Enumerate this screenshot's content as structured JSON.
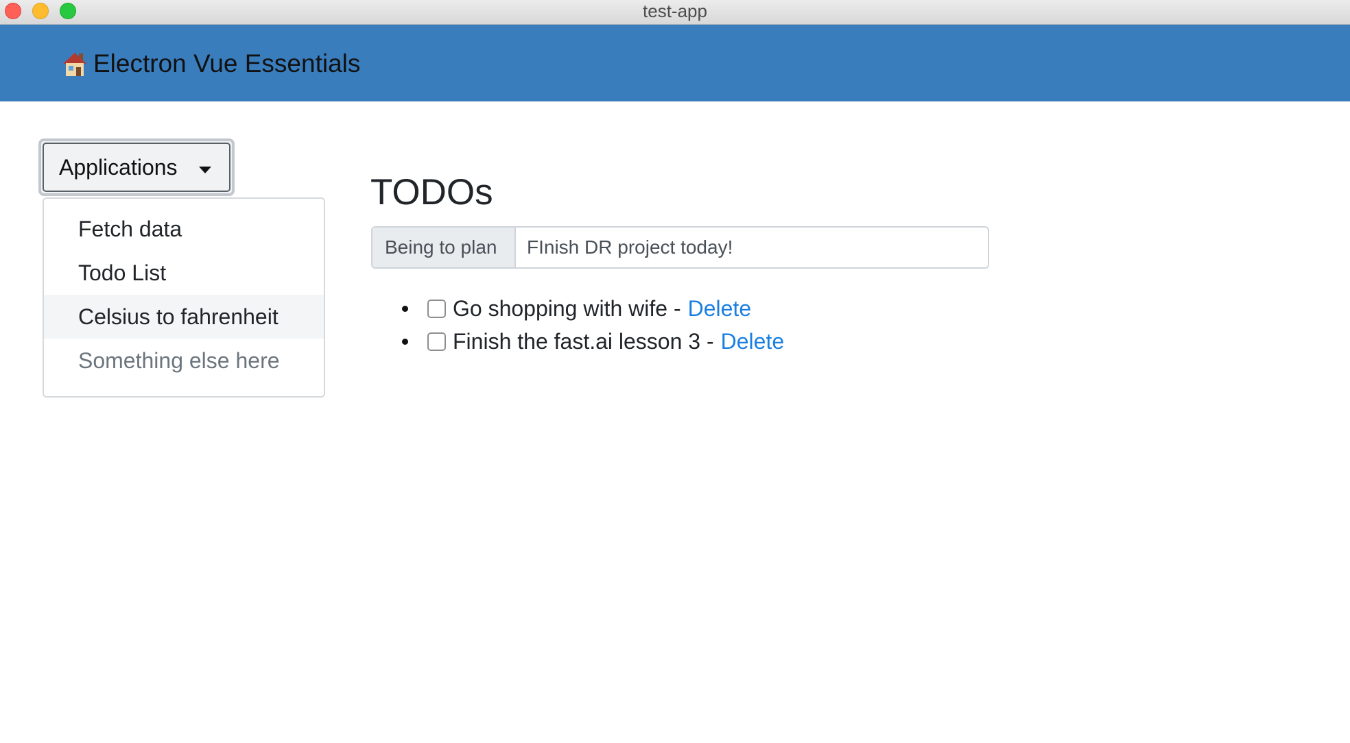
{
  "window": {
    "title": "test-app"
  },
  "navbar": {
    "brand": "Electron Vue Essentials",
    "brand_icon": "house-icon",
    "background": "#3a7dbd"
  },
  "dropdown": {
    "toggle_label": "Applications",
    "items": [
      {
        "label": "Fetch data",
        "state": "normal"
      },
      {
        "label": "Todo List",
        "state": "normal"
      },
      {
        "label": "Celsius to fahrenheit",
        "state": "hover"
      },
      {
        "label": "Something else here",
        "state": "disabled"
      }
    ]
  },
  "main": {
    "title": "TODOs",
    "input_prefix": "Being to plan",
    "input_value": "FInish DR project today!",
    "todos": [
      {
        "text": "Go shopping with wife -",
        "checked": false,
        "action": "Delete"
      },
      {
        "text": "Finish the fast.ai lesson 3 -",
        "checked": false,
        "action": "Delete"
      }
    ],
    "link_color": "#1a7fe0"
  }
}
